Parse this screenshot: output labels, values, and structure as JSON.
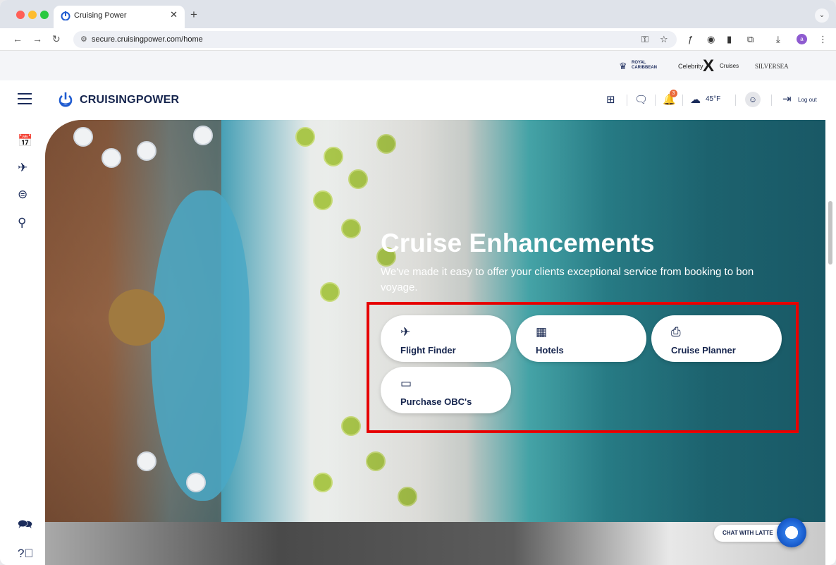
{
  "browser": {
    "tab_title": "Cruising Power",
    "tab_close": "✕",
    "new_tab": "+",
    "url": "secure.cruisingpower.com/home",
    "profile_initial": "a"
  },
  "brands": {
    "royal_caribbean": "ROYAL CARIBBEAN",
    "celebrity": "Celebrity",
    "celebrity_x": "X",
    "celebrity_cruises": "Cruises",
    "silversea": "SILVERSEA"
  },
  "header": {
    "logo_text": "CRUISINGPOWER",
    "notification_count": "3",
    "temperature": "45°F",
    "logout_label": "Log out"
  },
  "hero": {
    "title": "Cruise Enhancements",
    "subtitle": "We've made it easy to offer your clients exceptional service from booking to bon voyage.",
    "cards": [
      {
        "label": "Flight Finder",
        "icon": "plane-icon"
      },
      {
        "label": "Hotels",
        "icon": "building-icon"
      },
      {
        "label": "Cruise Planner",
        "icon": "planner-icon"
      },
      {
        "label": "Purchase OBC's",
        "icon": "card-icon"
      }
    ]
  },
  "chat": {
    "label": "CHAT WITH LATTE"
  },
  "colors": {
    "brand_navy": "#15244d",
    "highlight_red": "#e60000",
    "badge_orange": "#ea6a3a"
  }
}
